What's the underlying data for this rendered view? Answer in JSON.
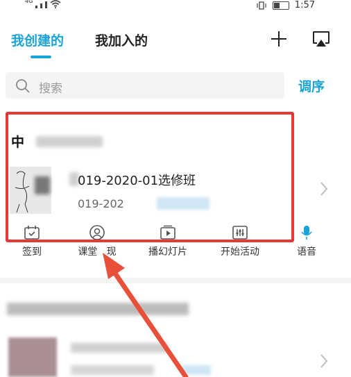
{
  "status_bar": {
    "time": "1:57",
    "network": "4G"
  },
  "tabs": [
    {
      "label": "我创建的",
      "active": true
    },
    {
      "label": "我加入的",
      "active": false
    }
  ],
  "toolbar": {
    "add_icon": "plus-icon",
    "cast_icon": "screen-cast-icon"
  },
  "search": {
    "placeholder": "搜索",
    "sort_label": "调序"
  },
  "course": {
    "title": "中",
    "class_name": "019-2020-01选修班",
    "class_sub": "019-202"
  },
  "actions": [
    {
      "label": "签到",
      "icon": "calendar-check-icon"
    },
    {
      "label": "课堂",
      "icon": "user-icon"
    },
    {
      "label": "播幻灯片",
      "icon": "play-slide-icon"
    },
    {
      "label": "开始活动",
      "icon": "activity-icon"
    },
    {
      "label": "语音",
      "icon": "microphone-icon"
    }
  ],
  "colors": {
    "accent": "#1aa3d9",
    "highlight": "#e53935",
    "arrow": "#e8503a"
  }
}
